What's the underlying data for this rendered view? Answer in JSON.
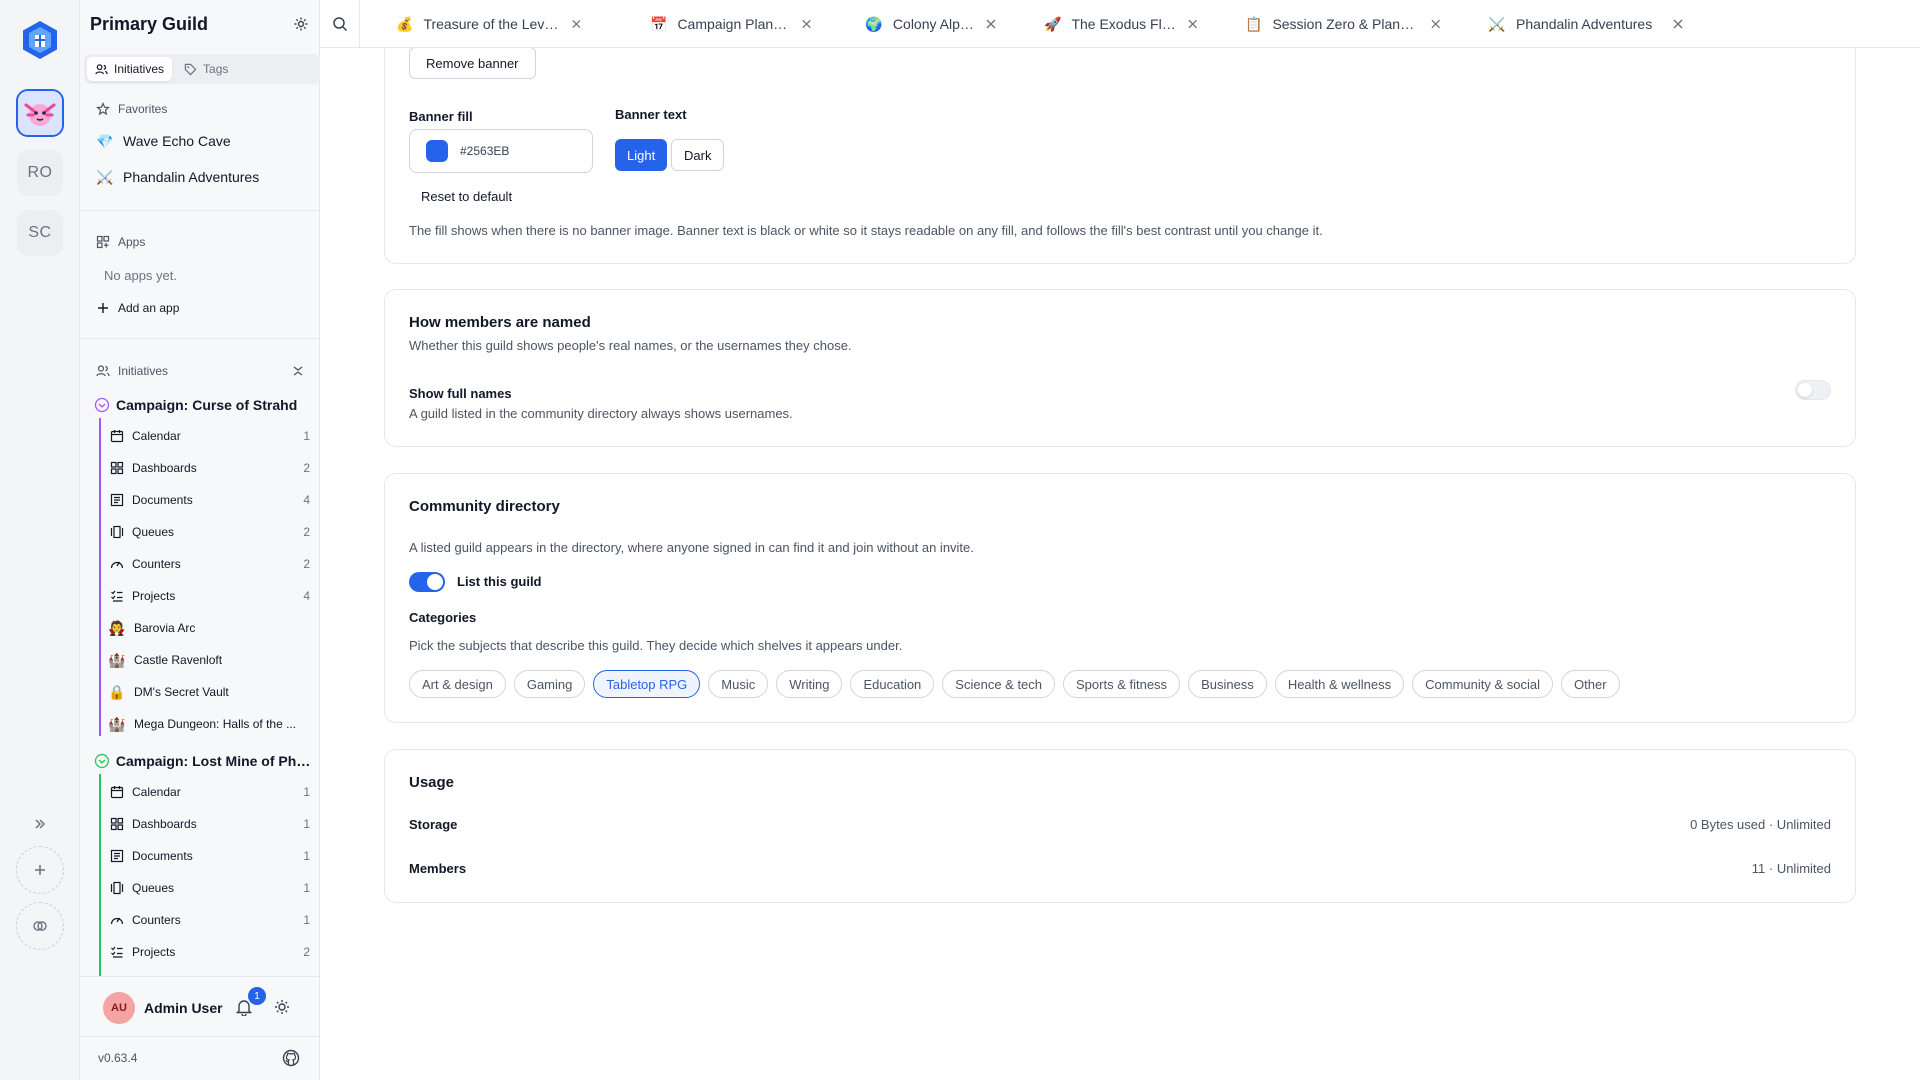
{
  "sidebar": {
    "title": "Primary Guild",
    "tabs": [
      {
        "label": "Initiatives",
        "active": true
      },
      {
        "label": "Tags",
        "active": false
      }
    ],
    "favorites": {
      "label": "Favorites",
      "items": [
        {
          "label": "Wave Echo Cave",
          "emoji": "💎"
        },
        {
          "label": "Phandalin Adventures",
          "emoji": "⚔️"
        }
      ]
    },
    "apps": {
      "label": "Apps",
      "empty": "No apps yet.",
      "add": "Add an app"
    },
    "initiatives": {
      "label": "Initiatives",
      "campaigns": [
        {
          "title": "Campaign: Curse of Strahd",
          "color": "#a855f7",
          "items": [
            {
              "label": "Calendar",
              "count": "1",
              "icon": "calendar-icon"
            },
            {
              "label": "Dashboards",
              "count": "2",
              "icon": "dashboard-icon"
            },
            {
              "label": "Documents",
              "count": "4",
              "icon": "documents-icon"
            },
            {
              "label": "Queues",
              "count": "2",
              "icon": "queues-icon"
            },
            {
              "label": "Counters",
              "count": "2",
              "icon": "counter-icon"
            },
            {
              "label": "Projects",
              "count": "4",
              "icon": "projects-icon"
            },
            {
              "label": "Barovia Arc",
              "count": "",
              "emoji": "🧛"
            },
            {
              "label": "Castle Ravenloft",
              "count": "",
              "emoji": "🏰"
            },
            {
              "label": "DM's Secret Vault",
              "count": "",
              "emoji": "🔒"
            },
            {
              "label": "Mega Dungeon: Halls of the ...",
              "count": "",
              "emoji": "🏰"
            }
          ]
        },
        {
          "title": "Campaign: Lost Mine of Pha...",
          "color": "#22c55e",
          "items": [
            {
              "label": "Calendar",
              "count": "1",
              "icon": "calendar-icon"
            },
            {
              "label": "Dashboards",
              "count": "1",
              "icon": "dashboard-icon"
            },
            {
              "label": "Documents",
              "count": "1",
              "icon": "documents-icon"
            },
            {
              "label": "Queues",
              "count": "1",
              "icon": "queues-icon"
            },
            {
              "label": "Counters",
              "count": "1",
              "icon": "counter-icon"
            },
            {
              "label": "Projects",
              "count": "2",
              "icon": "projects-icon"
            }
          ]
        }
      ]
    },
    "user": {
      "initials": "AU",
      "name": "Admin User",
      "notifications": "1"
    },
    "version": "v0.63.4"
  },
  "rail": {
    "avatars": [
      "RO",
      "SC"
    ]
  },
  "tabs": [
    {
      "label": "Treasure of the Leviath...",
      "emoji": "💰"
    },
    {
      "label": "Campaign Planning",
      "emoji": "📅"
    },
    {
      "label": "Colony Alpha",
      "emoji": "🌍"
    },
    {
      "label": "The Exodus Fleet",
      "emoji": "🚀"
    },
    {
      "label": "Session Zero & Planning",
      "emoji": "📋"
    },
    {
      "label": "Phandalin Adventures",
      "emoji": "⚔️"
    }
  ],
  "banner": {
    "remove_label": "Remove banner",
    "fill_label": "Banner fill",
    "fill_value": "#2563EB",
    "text_label": "Banner text",
    "light": "Light",
    "dark": "Dark",
    "reset": "Reset to default",
    "help": "The fill shows when there is no banner image. Banner text is black or white so it stays readable on any fill, and follows the fill's best contrast until you change it."
  },
  "naming": {
    "title": "How members are named",
    "subtitle": "Whether this guild shows people's real names, or the usernames they chose.",
    "toggle_label": "Show full names",
    "toggle_help": "A guild listed in the community directory always shows usernames.",
    "toggle_on": false
  },
  "directory": {
    "title": "Community directory",
    "subtitle": "A listed guild appears in the directory, where anyone signed in can find it and join without an invite.",
    "toggle_label": "List this guild",
    "toggle_on": true,
    "categories_label": "Categories",
    "categories_help": "Pick the subjects that describe this guild. They decide which shelves it appears under.",
    "categories": [
      {
        "label": "Art & design",
        "selected": false
      },
      {
        "label": "Gaming",
        "selected": false
      },
      {
        "label": "Tabletop RPG",
        "selected": true
      },
      {
        "label": "Music",
        "selected": false
      },
      {
        "label": "Writing",
        "selected": false
      },
      {
        "label": "Education",
        "selected": false
      },
      {
        "label": "Science & tech",
        "selected": false
      },
      {
        "label": "Sports & fitness",
        "selected": false
      },
      {
        "label": "Business",
        "selected": false
      },
      {
        "label": "Health & wellness",
        "selected": false
      },
      {
        "label": "Community & social",
        "selected": false
      },
      {
        "label": "Other",
        "selected": false
      }
    ]
  },
  "usage": {
    "title": "Usage",
    "storage_label": "Storage",
    "storage_value": "0 Bytes used · Unlimited",
    "members_label": "Members",
    "members_value": "11 · Unlimited"
  },
  "colors": {
    "accent": "#2563EB",
    "curse_of_strahd": "#a855f7",
    "lost_mine": "#22c55e"
  }
}
